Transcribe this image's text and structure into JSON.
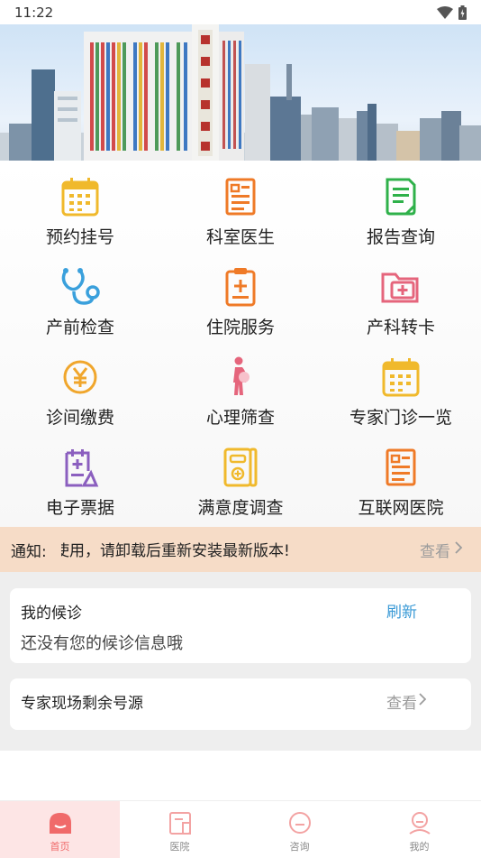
{
  "status_bar": {
    "time": "11:22"
  },
  "grid": {
    "items": [
      {
        "label": "预约挂号",
        "icon": "calendar-icon"
      },
      {
        "label": "科室医生",
        "icon": "document-icon"
      },
      {
        "label": "报告查询",
        "icon": "report-icon"
      },
      {
        "label": "产前检查",
        "icon": "stethoscope-icon"
      },
      {
        "label": "住院服务",
        "icon": "clipboard-plus-icon"
      },
      {
        "label": "产科转卡",
        "icon": "folder-plus-icon"
      },
      {
        "label": "诊间缴费",
        "icon": "yuan-icon"
      },
      {
        "label": "心理筛查",
        "icon": "pregnant-woman-icon"
      },
      {
        "label": "专家门诊一览",
        "icon": "calendar-icon"
      },
      {
        "label": "电子票据",
        "icon": "receipt-icon"
      },
      {
        "label": "满意度调查",
        "icon": "survey-icon"
      },
      {
        "label": "互联网医院",
        "icon": "document-icon"
      }
    ]
  },
  "notice": {
    "title": "通知:",
    "message": "使用，请卸载后重新安装最新版本!",
    "more_label": "查看"
  },
  "waiting_card": {
    "title": "我的候诊",
    "refresh_label": "刷新",
    "empty_text": "还没有您的候诊信息哦"
  },
  "expert_card": {
    "title": "专家现场剩余号源",
    "more_label": "查看"
  },
  "tabbar": {
    "tabs": [
      {
        "label": "首页",
        "active": true
      },
      {
        "label": "医院",
        "active": false
      },
      {
        "label": "咨询",
        "active": false
      },
      {
        "label": "我的",
        "active": false
      }
    ]
  },
  "colors": {
    "notice_bg": "#f6dcc7",
    "accent_blue": "#3a9ad6",
    "tab_active": "#f06a6a",
    "icon_orange": "#ef7a27",
    "icon_yellow": "#f0b92c",
    "icon_green": "#2fb14a",
    "icon_blue": "#3aa0dc",
    "icon_purple": "#8b5fbf",
    "icon_pink": "#e5657c"
  }
}
